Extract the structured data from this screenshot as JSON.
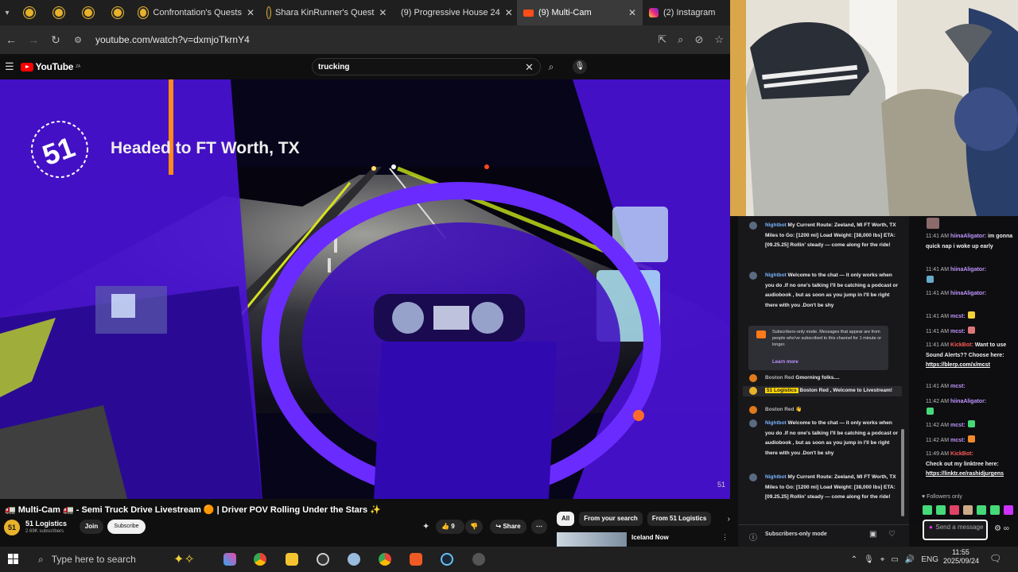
{
  "browser": {
    "tabs": [
      {
        "label": "Confrontation's Quests"
      },
      {
        "label": "Shara KinRunner's Quest"
      },
      {
        "label": "(9) Progressive House 24"
      },
      {
        "label": "(9)  Multi-Cam"
      },
      {
        "label": "(2) Instagram"
      }
    ],
    "url": "youtube.com/watch?v=dxmjoTkrnY4"
  },
  "youtube": {
    "logo_text": "YouTube",
    "logo_region": "ZA",
    "search_value": "trucking",
    "overlay_title": "Headed to FT Worth, TX",
    "watermark": "51",
    "video_title": "🚛 Multi-Cam 🚛 - Semi Truck Drive Livestream 🟠 | Driver POV Rolling Under the Stars ✨",
    "channel_name": "51 Logistics",
    "channel_subs": "2.69K subscribers",
    "channel_avatar_text": "51",
    "join_label": "Join",
    "subscribe_label": "Subscribe",
    "like_count": "9",
    "share_label": "Share",
    "chips": [
      "All",
      "From your search",
      "From 51 Logistics"
    ],
    "next_video_title": "Iceland Now"
  },
  "chat_left": {
    "messages": [
      {
        "user": "Nightbot",
        "text": "My Current Route: Zeeland, MI  FT Worth, TX  Miles to Go: [1200 mi]  Load Weight: [38,000 lbs]  ETA: [09.25.25]  Rollin' steady — come along for the ride!"
      },
      {
        "user": "Nightbot",
        "text": "Welcome to the chat  — it only works when you do  .If no one's talking  I'll be catching a podcast  or audiobook  , but as soon as you jump in  I'll be right there with you  .Don't be shy"
      },
      {
        "user": "Boston Red",
        "text": "Gmorning folks...."
      },
      {
        "user": "51 Logistics",
        "text": "Boston Red , Welcome to Livestream!"
      },
      {
        "user": "Boston Red",
        "text": ""
      },
      {
        "user": "Nightbot",
        "text": "Welcome to the chat  — it only works when you do  .If no one's talking  I'll be catching a podcast  or audiobook  , but as soon as you jump in  I'll be right there with you  .Don't be shy"
      },
      {
        "user": "Nightbot",
        "text": "My Current Route: Zeeland, MI  FT Worth, TX  Miles to Go: [1200 mi]  Load Weight: [38,000 lbs]  ETA: [09.25.25]  Rollin' steady — come along for the ride!"
      }
    ],
    "subscribers_notice": "Subscribers-only mode. Messages that appear are from people who've subscribed to this channel for 1 minute or longer.",
    "learn_more": "Learn more",
    "mode_label": "Subscribers-only mode"
  },
  "chat_right": {
    "messages": [
      {
        "time": "11:41 AM",
        "user": "hiinaAligator:",
        "text": "im gonna quick nap i woke up early"
      },
      {
        "time": "11:41 AM",
        "user": "hiinaAligator:",
        "text": ""
      },
      {
        "time": "11:41 AM",
        "user": "hiinaAligator:",
        "text": ""
      },
      {
        "time": "11:41 AM",
        "user": "mcst:",
        "text": ""
      },
      {
        "time": "11:41 AM",
        "user": "mcst:",
        "text": ""
      },
      {
        "time": "11:41 AM",
        "user": "KickBot:",
        "text": "Want to use Sound Alerts?? Choose here:",
        "link": "https://blerp.com/x/mcst"
      },
      {
        "time": "11:41 AM",
        "user": "mcst:",
        "text": ""
      },
      {
        "time": "11:42 AM",
        "user": "hiinaAligator:",
        "text": ""
      },
      {
        "time": "11:42 AM",
        "user": "mcst:",
        "text": ""
      },
      {
        "time": "11:42 AM",
        "user": "mcst:",
        "text": ""
      },
      {
        "time": "11:49 AM",
        "user": "KickBot:",
        "text": "Check out my linktree here:",
        "link": "https://linktr.ee/rashidjurgens"
      }
    ],
    "followers_only": "Followers only",
    "send_message": "Send a message"
  },
  "taskbar": {
    "search_placeholder": "Type here to search",
    "language": "ENG",
    "time": "11:55",
    "date": "2025/09/24"
  },
  "colors": {
    "youtube_red": "#ff0000",
    "kick_green": "#53fc18",
    "twitch_purple": "#bf94ff",
    "video_tint": "#5a14e8"
  }
}
